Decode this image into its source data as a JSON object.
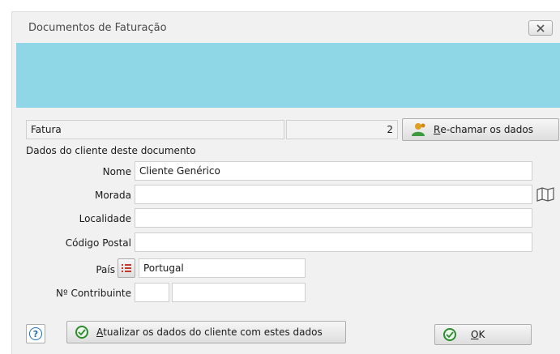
{
  "window": {
    "title": "Documentos de Faturação"
  },
  "document": {
    "type": "Fatura",
    "number": "2"
  },
  "buttons": {
    "recall_mnemonic": "R",
    "recall_rest": "e-chamar os dados",
    "update_mnemonic": "A",
    "update_rest": "tualizar os dados do cliente com estes dados",
    "ok_mnemonic": "O",
    "ok_rest": "K",
    "help_icon": "?"
  },
  "section": {
    "title": "Dados do cliente deste documento"
  },
  "fields": {
    "nome": {
      "label": "Nome",
      "value": "Cliente Genérico"
    },
    "morada": {
      "label": "Morada",
      "value": ""
    },
    "localidade": {
      "label": "Localidade",
      "value": ""
    },
    "codigo_postal": {
      "label": "Código Postal",
      "value": ""
    },
    "pais": {
      "label": "País",
      "value": "Portugal"
    },
    "contribuinte": {
      "label": "Nº Contribuinte",
      "prefix": "",
      "value": ""
    }
  },
  "icons": {
    "close": "close-icon",
    "recall": "person-icon",
    "map": "map-icon",
    "list": "list-icon",
    "help": "help-icon",
    "check": "check-icon"
  },
  "colors": {
    "banner": "#8fd7e6",
    "accent_green": "#2e8b2e"
  }
}
